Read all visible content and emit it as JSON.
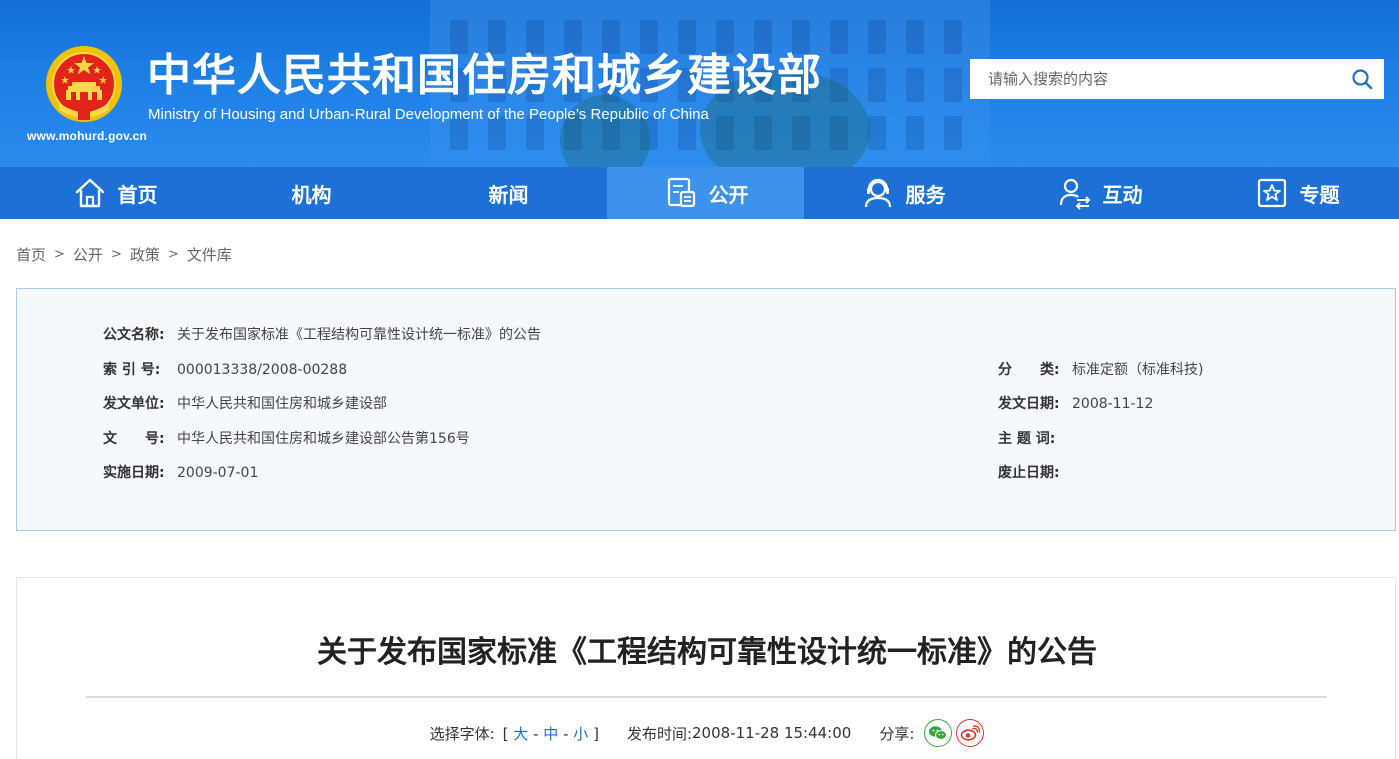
{
  "header": {
    "site_url": "www.mohurd.gov.cn",
    "title": "中华人民共和国住房和城乡建设部",
    "subtitle": "Ministry of Housing and Urban-Rural Development of the People’s Republic of China",
    "search_placeholder": "请输入搜索的内容",
    "emblem_icon": "national-emblem-icon"
  },
  "nav": {
    "items": [
      {
        "label": "首页",
        "icon": "home-icon",
        "active": false
      },
      {
        "label": "机构",
        "icon": "",
        "active": false
      },
      {
        "label": "新闻",
        "icon": "",
        "active": false
      },
      {
        "label": "公开",
        "icon": "document-icon",
        "active": true
      },
      {
        "label": "服务",
        "icon": "service-icon",
        "active": false
      },
      {
        "label": "互动",
        "icon": "interaction-icon",
        "active": false
      },
      {
        "label": "专题",
        "icon": "star-icon",
        "active": false
      }
    ]
  },
  "breadcrumb": {
    "items": [
      "首页",
      "公开",
      "政策",
      "文件库"
    ],
    "separator": ">"
  },
  "meta": {
    "name_label": "公文名称:",
    "name_value": "关于发布国家标准《工程结构可靠性设计统一标准》的公告",
    "index_label": "索 引 号:",
    "index_value": "000013338/2008-00288",
    "category_label": "分　　类:",
    "category_value": "标准定额（标准科技)",
    "issuer_label": "发文单位:",
    "issuer_value": "中华人民共和国住房和城乡建设部",
    "issue_date_label": "发文日期:",
    "issue_date_value": "2008-11-12",
    "docno_label": "文　　号:",
    "docno_value": "中华人民共和国住房和城乡建设部公告第156号",
    "subject_label": "主 题 词:",
    "subject_value": "",
    "effective_label": "实施日期:",
    "effective_value": "2009-07-01",
    "abolish_label": "废止日期:",
    "abolish_value": ""
  },
  "article": {
    "title": "关于发布国家标准《工程结构可靠性设计统一标准》的公告",
    "font_select_label": "选择字体:",
    "font_open": "[",
    "font_large": "大",
    "font_mid": "中",
    "font_small": "小",
    "font_close": "]",
    "dash": "-",
    "publish_label": "发布时间:",
    "publish_time": "2008-11-28 15:44:00",
    "share_label": "分享:",
    "share_wechat_icon": "wechat-icon",
    "share_weibo_icon": "weibo-icon",
    "colors": {
      "wechat": "#3aa53a",
      "weibo": "#e0312d",
      "link": "#1d6fd0"
    }
  },
  "colors": {
    "nav_bg": "#1d70d6",
    "nav_active": "#3d93ec",
    "meta_bg": "#f5f9fe",
    "meta_border": "#a9c8ea"
  }
}
